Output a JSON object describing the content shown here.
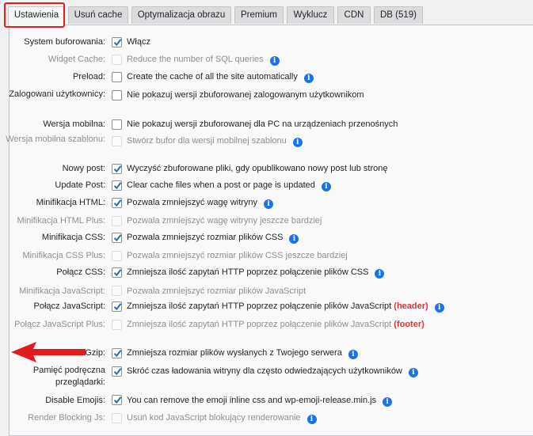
{
  "tabs": [
    {
      "label": "Ustawienia",
      "active": true
    },
    {
      "label": "Usuń cache"
    },
    {
      "label": "Optymalizacja obrazu"
    },
    {
      "label": "Premium"
    },
    {
      "label": "Wyklucz"
    },
    {
      "label": "CDN"
    },
    {
      "label": "DB (519)"
    }
  ],
  "settings": [
    {
      "label": "System buforowania:",
      "checked": true,
      "disabled": false,
      "desc": "Włącz",
      "info": false
    },
    {
      "label": "Widget Cache:",
      "checked": false,
      "disabled": true,
      "desc": "Reduce the number of SQL queries",
      "info": true
    },
    {
      "label": "Preload:",
      "checked": false,
      "disabled": false,
      "desc": "Create the cache of all the site automatically",
      "info": true
    },
    {
      "label": "Zalogowani użytkownicy:",
      "checked": false,
      "disabled": false,
      "desc": "Nie pokazuj wersji zbuforowanej zalogowanym użytkownikom",
      "info": false
    },
    {
      "label": "Wersja mobilna:",
      "checked": false,
      "disabled": false,
      "desc": "Nie pokazuj wersji zbuforowanej dla PC na urządzeniach przenośnych",
      "info": false
    },
    {
      "label": "Wersja mobilna szablonu:",
      "checked": false,
      "disabled": true,
      "desc": "Stwórz bufor dla wersji mobilnej szablonu",
      "info": true
    },
    {
      "label": "Nowy post:",
      "checked": true,
      "disabled": false,
      "desc": "Wyczyść zbuforowane pliki, gdy opublikowano nowy post lub stronę",
      "info": false
    },
    {
      "label": "Update Post:",
      "checked": true,
      "disabled": false,
      "desc": "Clear cache files when a post or page is updated",
      "info": true
    },
    {
      "label": "Minifikacja HTML:",
      "checked": true,
      "disabled": false,
      "desc": "Pozwala zmniejszyć wagę witryny",
      "info": true
    },
    {
      "label": "Minifikacja HTML Plus:",
      "checked": false,
      "disabled": true,
      "desc": "Pozwala zmniejszyć wagę witryny jeszcze bardziej",
      "info": false
    },
    {
      "label": "Minifikacja CSS:",
      "checked": true,
      "disabled": false,
      "desc": "Pozwala zmniejszyć rozmiar plików CSS",
      "info": true
    },
    {
      "label": "Minifikacja CSS Plus:",
      "checked": false,
      "disabled": true,
      "desc": "Pozwala zmniejszyć rozmiar plików CSS jeszcze bardziej",
      "info": false
    },
    {
      "label": "Połącz CSS:",
      "checked": true,
      "disabled": false,
      "desc": "Zmniejsza ilość zapytań HTTP poprzez połączenie plików CSS",
      "info": true
    },
    {
      "label": "Minifikacja JavaScript:",
      "checked": false,
      "disabled": true,
      "desc": "Pozwala zmniejszyć rozmiar plików JavaScript",
      "info": false
    },
    {
      "label": "Połącz JavaScript:",
      "checked": true,
      "disabled": false,
      "desc": "Zmniejsza ilość zapytań HTTP poprzez połączenie plików JavaScript",
      "extra": "(header)",
      "info": true
    },
    {
      "label": "Połącz JavaScript Plus:",
      "checked": false,
      "disabled": true,
      "desc": "Zmniejsza ilość zapytań HTTP poprzez połączenie plików JavaScript",
      "extra": "(footer)",
      "info": false
    },
    {
      "label": "Gzip:",
      "checked": true,
      "disabled": false,
      "desc": "Zmniejsza rozmiar plików wysłanych z Twojego serwera",
      "info": true
    },
    {
      "label": "Pamięć podręczna przeglądarki:",
      "checked": true,
      "disabled": false,
      "desc": "Skróć czas ładowania witryny dla często odwiedzających użytkowników",
      "info": true
    },
    {
      "label": "Disable Emojis:",
      "checked": true,
      "disabled": false,
      "desc": "You can remove the emoji inline css and wp-emoji-release.min.js",
      "info": true
    },
    {
      "label": "Render Blocking Js:",
      "checked": false,
      "disabled": true,
      "desc": "Usuń kod JavaScript blokujący renderowanie",
      "info": true
    }
  ],
  "colors": {
    "accent": "#1a73e8",
    "highlight": "#e21c1c",
    "extra_text": "#d63638"
  }
}
